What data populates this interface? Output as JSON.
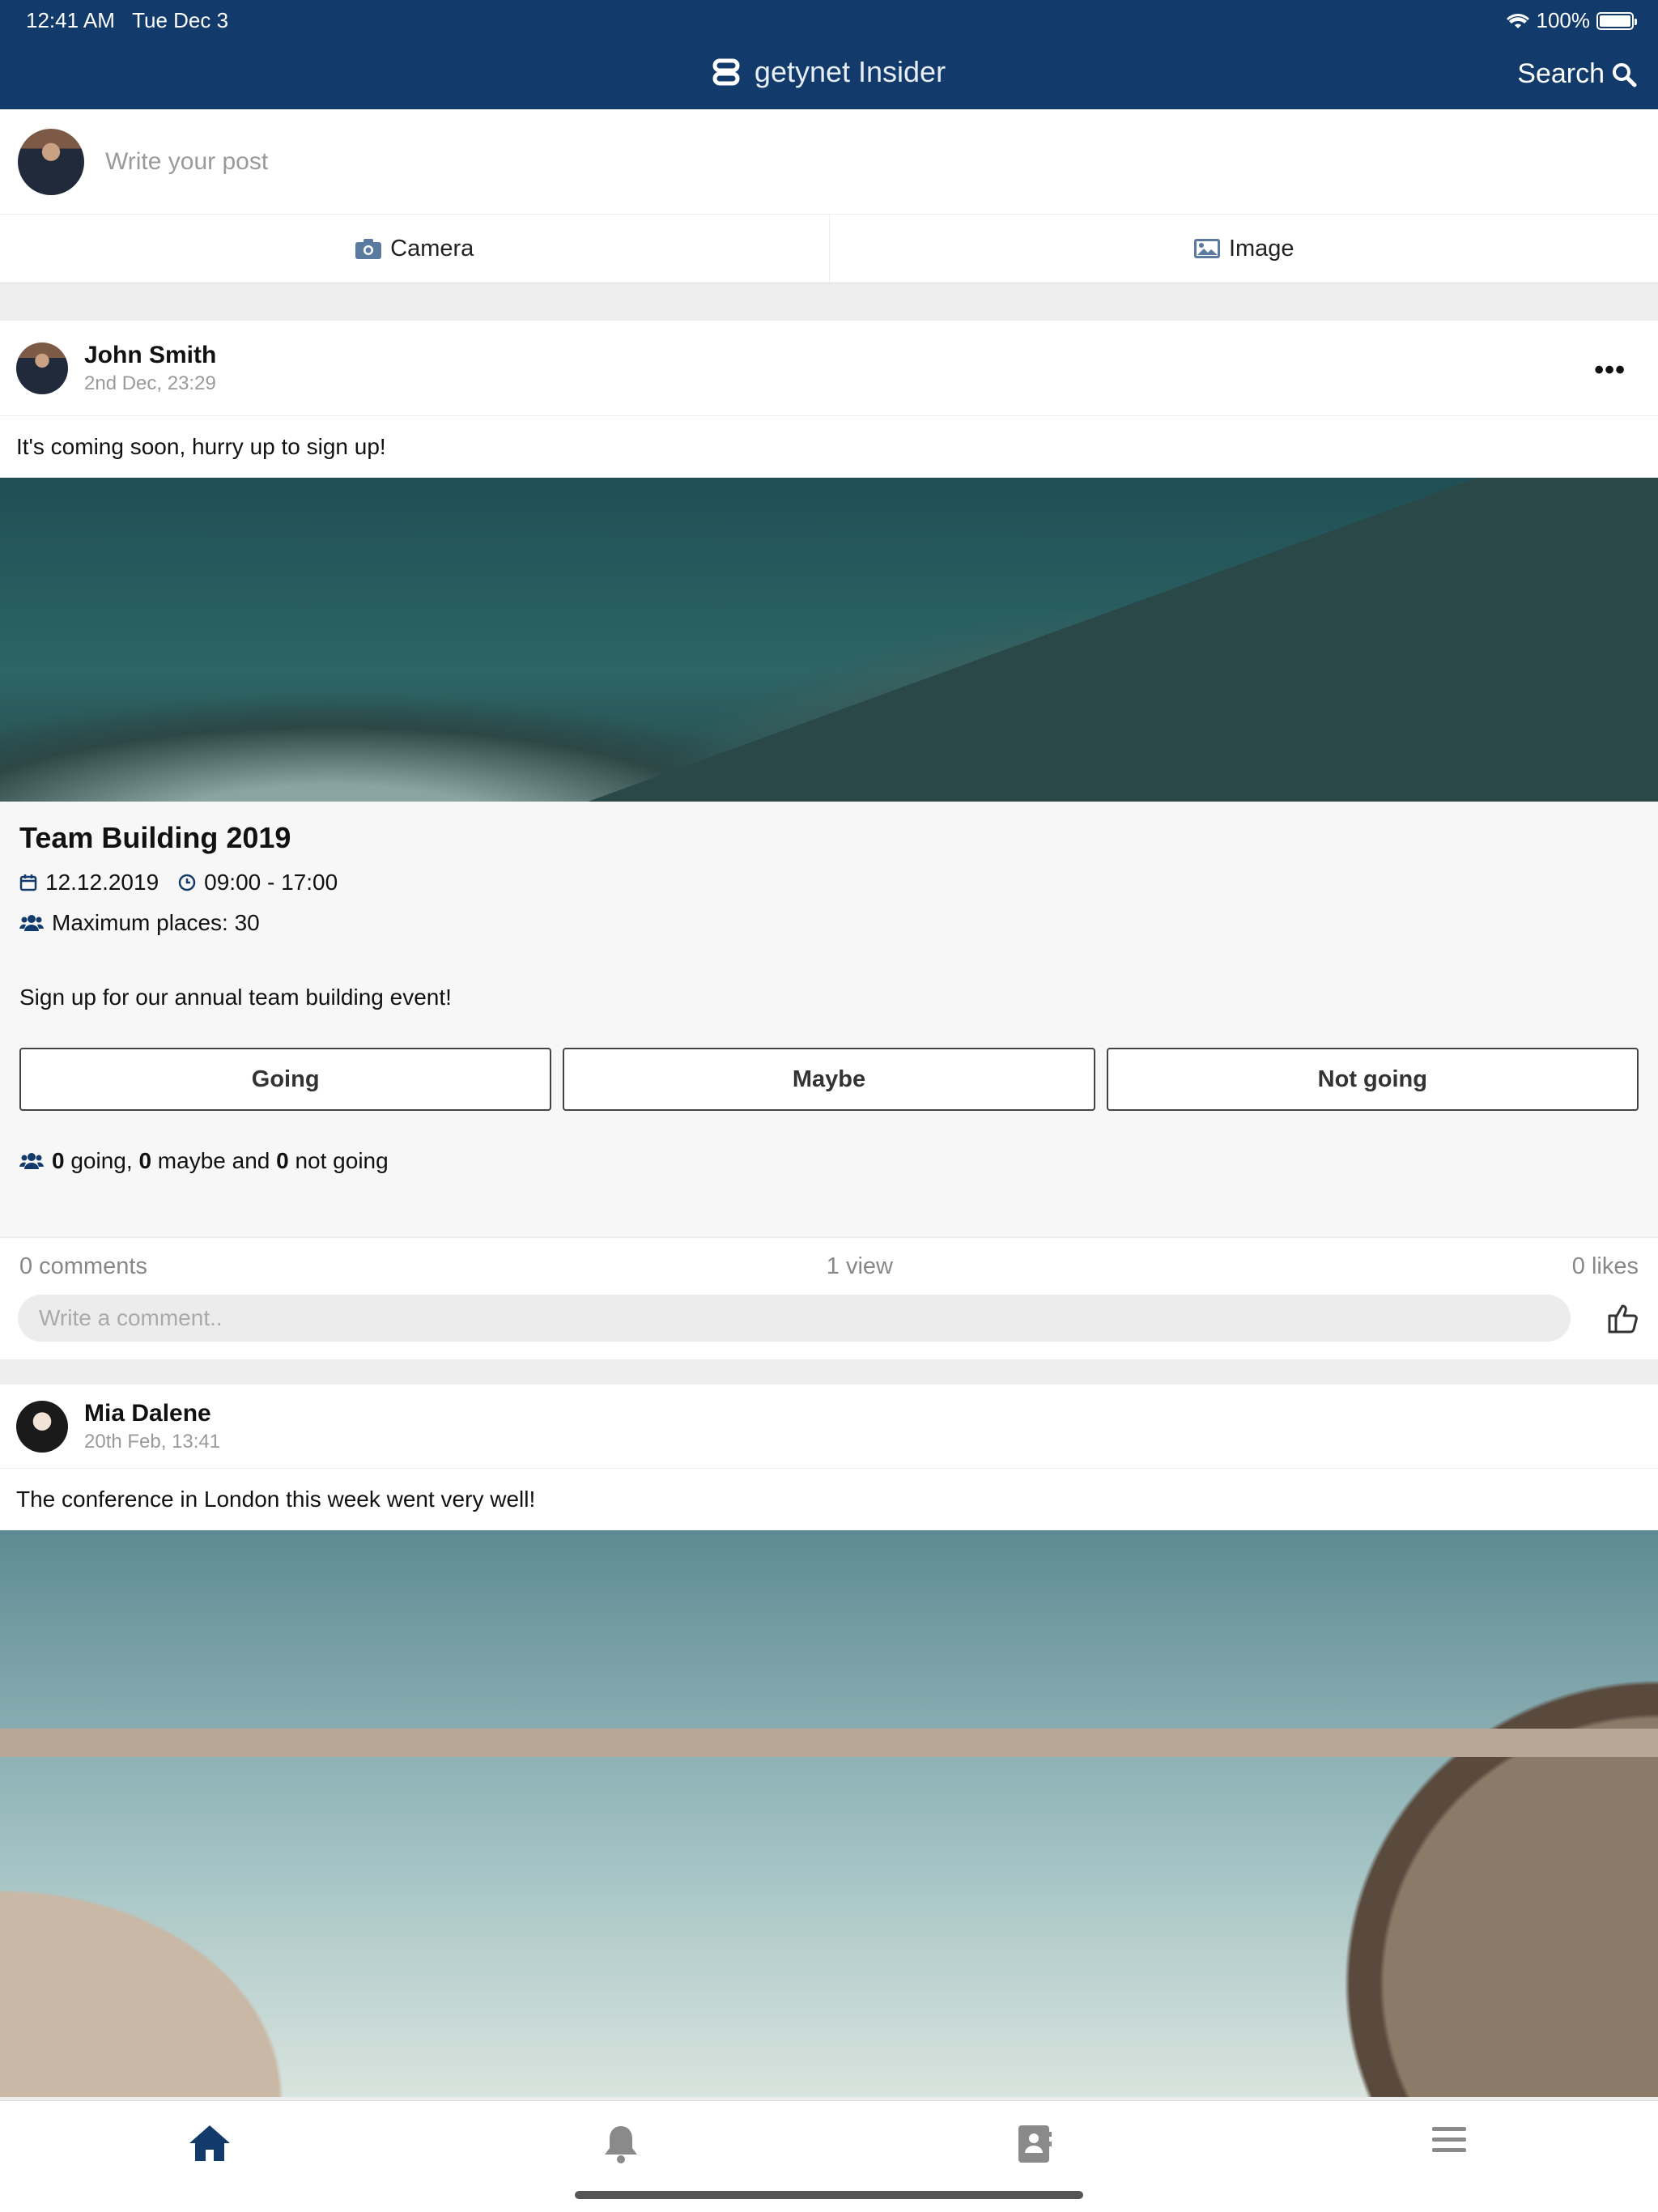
{
  "status_bar": {
    "time": "12:41 AM",
    "date": "Tue Dec 3",
    "battery": "100%",
    "battery_level": 1.0
  },
  "header": {
    "brand": "getynet Insider",
    "search_label": "Search"
  },
  "composer": {
    "placeholder": "Write your post",
    "camera_label": "Camera",
    "image_label": "Image"
  },
  "posts": [
    {
      "author": "John Smith",
      "timestamp": "2nd Dec, 23:29",
      "text": "It's coming soon, hurry up to sign up!",
      "event": {
        "title": "Team Building 2019",
        "date": "12.12.2019",
        "time": "09:00 - 17:00",
        "capacity": "Maximum places: 30",
        "description": "Sign up for our annual team building event!",
        "buttons": [
          "Going",
          "Maybe",
          "Not going"
        ],
        "going_count": "0",
        "going_label": " going, ",
        "maybe_count": "0",
        "maybe_label": " maybe and ",
        "not_going_count": "0",
        "not_going_label": " not going"
      },
      "comments": "0 comments",
      "views": "1 view",
      "likes": "0 likes",
      "comment_placeholder": "Write a comment.."
    },
    {
      "author": "Mia Dalene",
      "timestamp": "20th Feb, 13:41",
      "text": "The conference in London this week went very well!"
    }
  ],
  "tabs": [
    "home-icon",
    "bell-icon",
    "contacts-icon",
    "menu-icon"
  ],
  "colors": {
    "primary": "#123b6b",
    "inactive_icon": "#8a8a8a"
  }
}
